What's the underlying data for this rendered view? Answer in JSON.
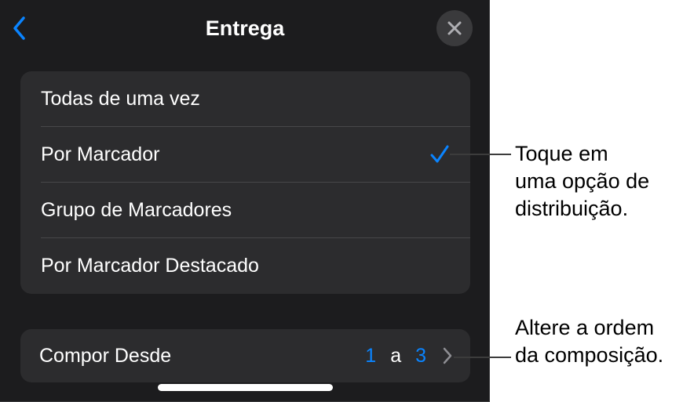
{
  "header": {
    "title": "Entrega"
  },
  "options": [
    {
      "label": "Todas de uma vez",
      "selected": false
    },
    {
      "label": "Por Marcador",
      "selected": true
    },
    {
      "label": "Grupo de Marcadores",
      "selected": false
    },
    {
      "label": "Por Marcador Destacado",
      "selected": false
    }
  ],
  "build_order": {
    "label": "Compor Desde",
    "from": "1",
    "separator": "a",
    "to": "3"
  },
  "callouts": {
    "delivery": [
      "Toque em",
      "uma opção de",
      "distribuição."
    ],
    "order": [
      "Altere a ordem",
      "da composição."
    ]
  },
  "colors": {
    "background": "#1c1c1e",
    "group": "#2c2c2e",
    "accent": "#0a84ff"
  },
  "icons": {
    "back": "chevron-left-icon",
    "close": "close-icon",
    "check": "checkmark-icon",
    "disclosure": "chevron-right-icon"
  }
}
